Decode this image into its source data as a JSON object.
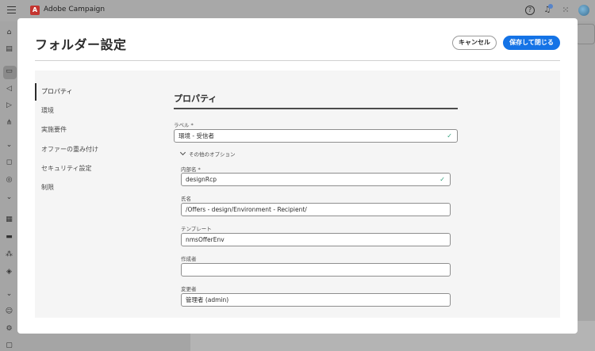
{
  "app": {
    "name": "Adobe Campaign",
    "logo_letter": "A"
  },
  "modal": {
    "title": "フォルダー設定",
    "cancel_label": "キャンセル",
    "save_label": "保存して閉じる"
  },
  "side_nav": {
    "items": [
      {
        "label": "プロパティ",
        "active": true
      },
      {
        "label": "環境",
        "active": false
      },
      {
        "label": "実施要件",
        "active": false
      },
      {
        "label": "オファーの重み付け",
        "active": false
      },
      {
        "label": "セキュリティ設定",
        "active": false
      },
      {
        "label": "制限",
        "active": false
      }
    ]
  },
  "properties": {
    "section_title": "プロパティ",
    "label_field": {
      "label": "ラベル",
      "required_mark": "*",
      "value": "環境 - 受信者"
    },
    "more_options": "その他のオプション",
    "internal_name": {
      "label": "内部名",
      "required_mark": "*",
      "value": "designRcp"
    },
    "full_name": {
      "label": "氏名",
      "value": "/Offers - design/Environment - Recipient/"
    },
    "template": {
      "label": "テンプレート",
      "value": "nmsOfferEnv"
    },
    "created_by": {
      "label": "作成者",
      "value": ""
    },
    "modified_by": {
      "label": "変更者",
      "value": "管理者 (admin)"
    }
  },
  "icons": {
    "valid_icon": "check-icon",
    "accent_color": "#1473e6",
    "valid_color": "#2d9d78"
  }
}
